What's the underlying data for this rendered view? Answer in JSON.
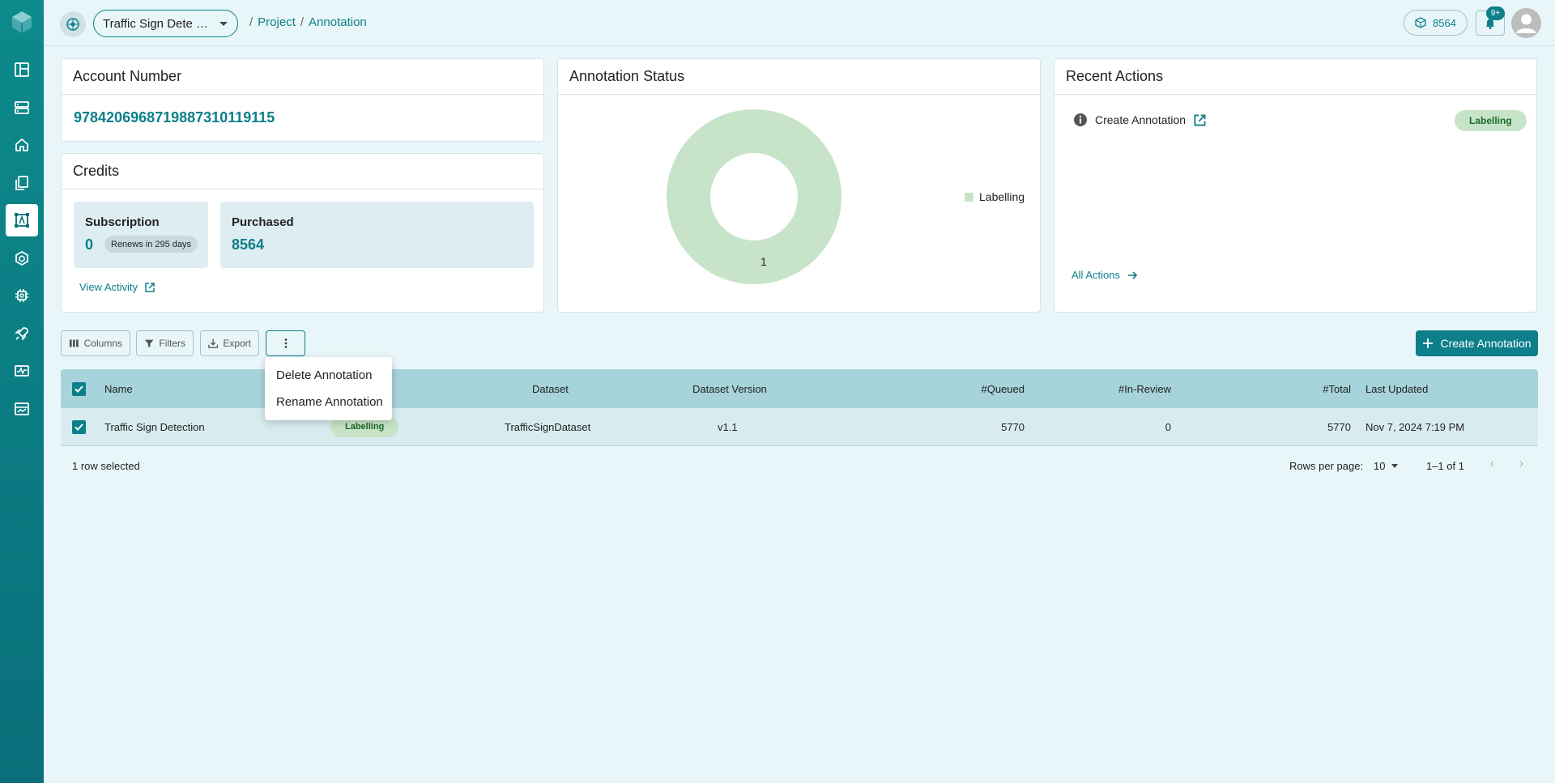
{
  "header": {
    "project_select": "Traffic Sign Dete …",
    "breadcrumb": [
      "Project",
      "Annotation"
    ],
    "credits": "8564",
    "notifications_badge": "9+"
  },
  "account": {
    "title": "Account Number",
    "number": "97842069687198873101191 15"
  },
  "credits": {
    "title": "Credits",
    "subscription_label": "Subscription",
    "subscription_value": "0",
    "renews": "Renews in 295 days",
    "purchased_label": "Purchased",
    "purchased_value": "8564",
    "view_activity": "View Activity"
  },
  "status": {
    "title": "Annotation Status",
    "legend": "Labelling",
    "count_label": "1"
  },
  "chart_data": {
    "type": "pie",
    "categories": [
      "Labelling"
    ],
    "values": [
      1
    ],
    "colors": [
      "#c7e4c8"
    ],
    "legend_position": "right"
  },
  "recent": {
    "title": "Recent Actions",
    "item_label": "Create Annotation",
    "item_status": "Labelling",
    "all_actions": "All Actions"
  },
  "toolbar": {
    "columns": "Columns",
    "filters": "Filters",
    "export": "Export",
    "create": "Create Annotation"
  },
  "menu": {
    "items": [
      "Delete Annotation",
      "Rename Annotation"
    ]
  },
  "table": {
    "headers": [
      "Name",
      "Dataset",
      "Dataset Version",
      "#Queued",
      "#In-Review",
      "#Total",
      "Last Updated"
    ],
    "rows": [
      {
        "name": "Traffic Sign Detection",
        "status": "Labelling",
        "dataset": "TrafficSignDataset",
        "version": "v1.1",
        "queued": "5770",
        "in_review": "0",
        "total": "5770",
        "updated": "Nov 7, 2024 7:19 PM"
      }
    ],
    "selected_text": "1 row selected",
    "rows_per_page_label": "Rows per page:",
    "rows_per_page": "10",
    "page_info": "1–1 of 1"
  },
  "colors": {
    "accent": "#0c7f8a",
    "sidebar": "#0c8a8c",
    "chip": "#c7e4c8"
  }
}
